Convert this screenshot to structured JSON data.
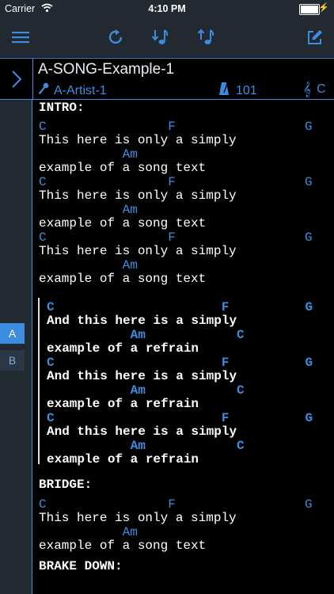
{
  "status": {
    "carrier": "Carrier",
    "time": "4:10 PM",
    "battery_level": 1.0
  },
  "toolbar": {
    "menu_icon": "hamburger-menu-icon",
    "reload_icon": "reload-icon",
    "transpose_down_icon": "note-arrow-down-icon",
    "transpose_up_icon": "note-arrow-up-icon",
    "edit_icon": "edit-icon"
  },
  "header": {
    "title": "A-SONG-Example-1",
    "artist": "A-Artist-1",
    "tempo": "101",
    "key": "C"
  },
  "sections": {
    "intro": {
      "label": "INTRO:",
      "lines": [
        "C                F                 G",
        "This here is only a simply",
        "           Am",
        "example of a song text",
        "C                F                 G",
        "This here is only a simply",
        "           Am",
        "example of a song text",
        "C                F                 G",
        "This here is only a simply",
        "           Am",
        "example of a song text"
      ]
    },
    "refrain": {
      "lines": [
        "C                      F          G",
        "And this here is a simply",
        "           Am            C",
        "example of a refrain",
        "C                      F          G",
        "And this here is a simply",
        "           Am            C",
        "example of a refrain",
        "C                      F          G",
        "And this here is a simply",
        "           Am            C",
        "example of a refrain"
      ]
    },
    "bridge": {
      "label": "BRIDGE:",
      "lines": [
        "C                F                 G",
        "This here is only a simply",
        "           Am",
        "example of a song text"
      ]
    },
    "brake": {
      "label": "BRAKE DOWN:"
    }
  },
  "sidebar": {
    "sections": [
      {
        "label": "A",
        "active": true
      },
      {
        "label": "B",
        "active": false
      }
    ]
  },
  "colors": {
    "accent": "#3c8de0",
    "bar": "#222931",
    "background": "#000000"
  }
}
